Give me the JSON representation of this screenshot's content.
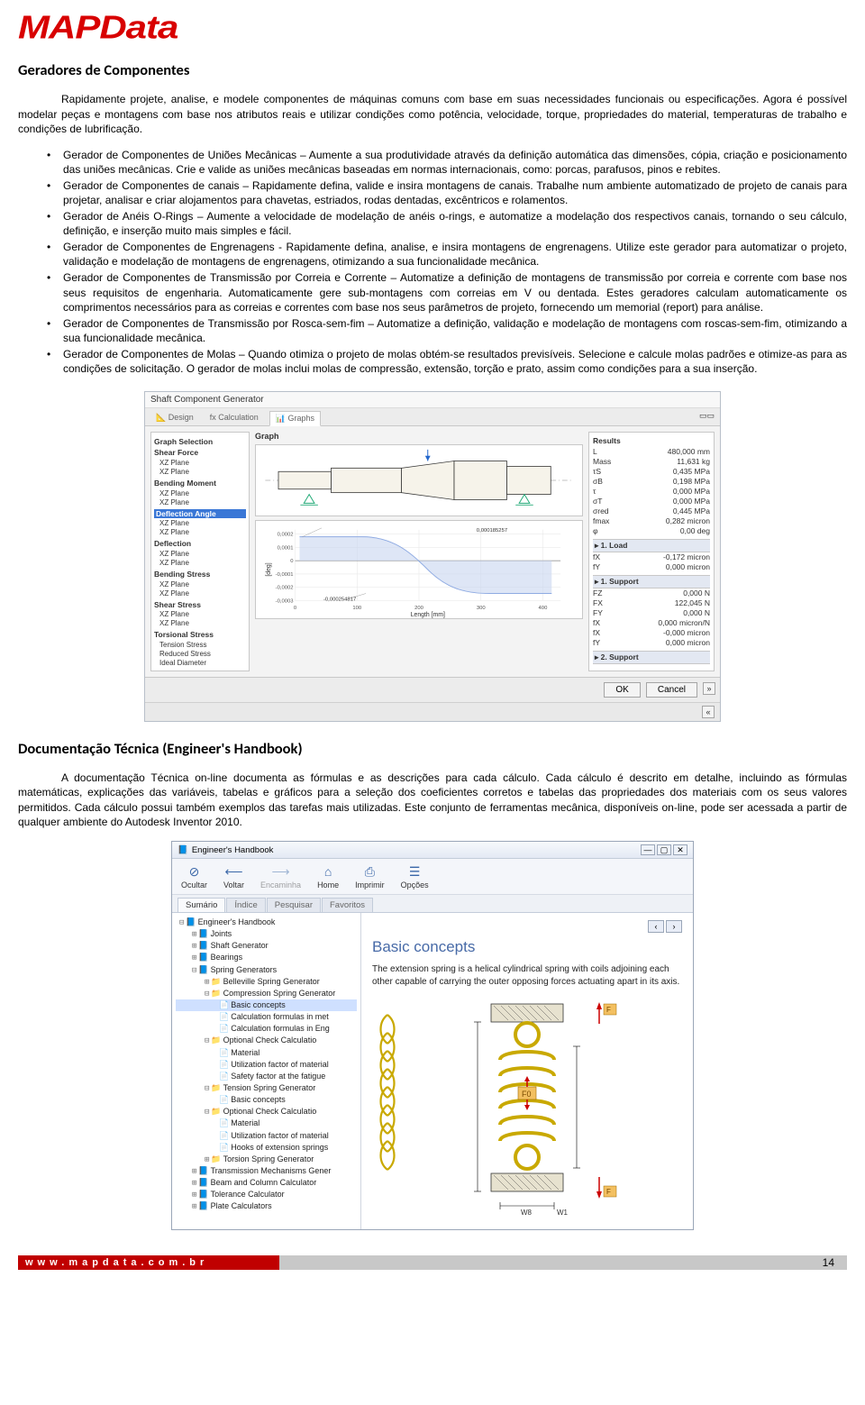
{
  "logo": "MAPData",
  "section1_title": "Geradores de Componentes",
  "p1": "Rapidamente projete, analise, e modele componentes de máquinas comuns com base em suas necessidades funcionais ou especificações. Agora é possível modelar peças e montagens com base nos atributos reais e utilizar condições como potência, velocidade, torque, propriedades do material, temperaturas de trabalho e condições de lubrificação.",
  "bullets": [
    "Gerador de Componentes de Uniões Mecânicas – Aumente a sua produtividade através da definição automática das dimensões, cópia, criação e posicionamento das uniões mecânicas. Crie e valide as uniões mecânicas baseadas em normas internacionais, como: porcas, parafusos, pinos e rebites.",
    "Gerador de Componentes de canais – Rapidamente defina, valide e insira montagens de canais. Trabalhe num ambiente automatizado de projeto de canais para projetar, analisar e criar alojamentos para chavetas, estriados, rodas dentadas, excêntricos e rolamentos.",
    "Gerador de Anéis O-Rings – Aumente a velocidade de modelação de anéis o-rings, e automatize a modelação dos respectivos canais, tornando o seu cálculo, definição, e inserção muito mais simples e fácil.",
    "Gerador de Componentes de Engrenagens - Rapidamente defina, analise, e insira montagens de engrenagens. Utilize este gerador para automatizar o projeto, validação e modelação de montagens de engrenagens, otimizando a sua funcionalidade mecânica.",
    "Gerador de Componentes de Transmissão por Correia e Corrente – Automatize a definição de montagens de transmissão por correia e corrente com base nos seus requisitos de engenharia. Automaticamente gere sub-montagens com correias em V ou dentada. Estes geradores calculam automaticamente os comprimentos necessários para as correias e correntes com base nos seus parâmetros de projeto, fornecendo um memorial (report) para análise.",
    "Gerador de Componentes de Transmissão por Rosca-sem-fim – Automatize a definição, validação e modelação de montagens com roscas-sem-fim, otimizando a sua funcionalidade mecânica.",
    "Gerador de Componentes de Molas – Quando otimiza o projeto de molas obtém-se resultados previsíveis. Selecione e calcule molas padrões e otimize-as para as condições de solicitação. O gerador de molas inclui molas de compressão, extensão, torção e prato, assim como condições para a sua inserção."
  ],
  "shaft": {
    "title": "Shaft Component Generator",
    "tabs": [
      "Design",
      "Calculation",
      "Graphs"
    ],
    "active_tab": 2,
    "left_header": "Graph Selection",
    "left_items": [
      {
        "hdr": "Shear Force"
      },
      {
        "txt": "XZ Plane"
      },
      {
        "txt": "XZ Plane"
      },
      {
        "hdr": "Bending Moment"
      },
      {
        "txt": "XZ Plane"
      },
      {
        "txt": "XZ Plane"
      },
      {
        "hdr": "Deflection Angle",
        "sel": true
      },
      {
        "txt": "XZ Plane"
      },
      {
        "txt": "XZ Plane"
      },
      {
        "hdr": "Deflection"
      },
      {
        "txt": "XZ Plane"
      },
      {
        "txt": "XZ Plane"
      },
      {
        "hdr": "Bending Stress"
      },
      {
        "txt": "XZ Plane"
      },
      {
        "txt": "XZ Plane"
      },
      {
        "hdr": "Shear Stress"
      },
      {
        "txt": "XZ Plane"
      },
      {
        "txt": "XZ Plane"
      },
      {
        "hdr": "Torsional Stress"
      },
      {
        "txt": "Tension Stress"
      },
      {
        "txt": "Reduced Stress"
      },
      {
        "txt": "Ideal Diameter"
      }
    ],
    "mid_label": "Graph",
    "plot_xlabel": "Length [mm]",
    "plot_ylabel": "[deg]",
    "plot_callout1": "0,000185257",
    "plot_callout2": "-0,000254817",
    "results_title": "Results",
    "results_rows": [
      [
        "L",
        "480,000 mm"
      ],
      [
        "Mass",
        "11,631 kg"
      ],
      [
        "τS",
        "0,435 MPa"
      ],
      [
        "σB",
        "0,198 MPa"
      ],
      [
        "τ",
        "0,000 MPa"
      ],
      [
        "σT",
        "0,000 MPa"
      ],
      [
        "σred",
        "0,445 MPa"
      ],
      [
        "fmax",
        "0,282 micron"
      ],
      [
        "φ",
        "0,00 deg"
      ]
    ],
    "load_title": "1. Load",
    "load_rows": [
      [
        "fX",
        "-0,172 micron"
      ],
      [
        "fY",
        "0,000 micron"
      ]
    ],
    "support_title": "1. Support",
    "support_rows": [
      [
        "FZ",
        "0,000 N"
      ],
      [
        "FX",
        "122,045 N"
      ],
      [
        "FY",
        "0,000 N"
      ],
      [
        "fX",
        "0,000 micron/N"
      ],
      [
        "fX",
        "-0,000 micron"
      ],
      [
        "fY",
        "0,000 micron"
      ]
    ],
    "support2_title": "2. Support",
    "btn_ok": "OK",
    "btn_cancel": "Cancel"
  },
  "chart_data": {
    "type": "line",
    "title": "Deflection Angle – XZ Plane",
    "xlabel": "Length [mm]",
    "ylabel": "[deg]",
    "x": [
      0,
      100,
      200,
      300,
      400
    ],
    "y": [
      0.000185,
      0.000185,
      5e-05,
      -0.00025,
      -0.00025
    ],
    "xlim": [
      0,
      450
    ],
    "ylim": [
      -0.0003,
      0.0002
    ],
    "yticks": [
      0.0002,
      0.0001,
      0,
      -0.0001,
      -0.0002,
      -0.0003
    ],
    "annotations": [
      {
        "x": 10,
        "y": 0.000185,
        "text": "0,000185257"
      },
      {
        "x": 120,
        "y": -0.000255,
        "text": "-0,000254817"
      }
    ]
  },
  "section2_title": "Documentação Técnica (Engineer's Handbook)",
  "p2": "A documentação Técnica on-line documenta as fórmulas e as descrições para cada cálculo. Cada cálculo é descrito em detalhe, incluindo as fórmulas matemáticas, explicações das variáveis, tabelas e gráficos para a seleção dos coeficientes corretos e tabelas das propriedades dos materiais com os seus valores permitidos. Cada cálculo possui também exemplos das tarefas mais utilizadas. Este conjunto de ferramentas mecânica, disponíveis on-line, pode ser acessada a partir de qualquer ambiente do Autodesk Inventor 2010.",
  "hb": {
    "title": "Engineer's Handbook",
    "toolbar": [
      {
        "icon": "⊘",
        "label": "Ocultar"
      },
      {
        "icon": "⟵",
        "label": "Voltar"
      },
      {
        "icon": "⟶",
        "label": "Encaminha"
      },
      {
        "icon": "⌂",
        "label": "Home"
      },
      {
        "icon": "⎙",
        "label": "Imprimir"
      },
      {
        "icon": "☰",
        "label": "Opções"
      }
    ],
    "tabs": [
      "Sumário",
      "Índice",
      "Pesquisar",
      "Favoritos"
    ],
    "tree": [
      {
        "lvl": 0,
        "exp": "⊟",
        "ico": "book",
        "txt": "Engineer's Handbook"
      },
      {
        "lvl": 1,
        "exp": "⊞",
        "ico": "book",
        "txt": "Joints"
      },
      {
        "lvl": 1,
        "exp": "⊞",
        "ico": "book",
        "txt": "Shaft Generator"
      },
      {
        "lvl": 1,
        "exp": "⊞",
        "ico": "book",
        "txt": "Bearings"
      },
      {
        "lvl": 1,
        "exp": "⊟",
        "ico": "book",
        "txt": "Spring Generators"
      },
      {
        "lvl": 2,
        "exp": "⊞",
        "ico": "folder",
        "txt": "Belleville Spring Generator"
      },
      {
        "lvl": 2,
        "exp": "⊟",
        "ico": "folder",
        "txt": "Compression Spring Generator"
      },
      {
        "lvl": 3,
        "exp": "",
        "ico": "page",
        "txt": "Basic concepts",
        "sel": true
      },
      {
        "lvl": 3,
        "exp": "",
        "ico": "page",
        "txt": "Calculation formulas in met"
      },
      {
        "lvl": 3,
        "exp": "",
        "ico": "page",
        "txt": "Calculation formulas in Eng"
      },
      {
        "lvl": 2,
        "exp": "⊟",
        "ico": "folder",
        "txt": "Optional Check Calculatio"
      },
      {
        "lvl": 3,
        "exp": "",
        "ico": "page",
        "txt": "Material"
      },
      {
        "lvl": 3,
        "exp": "",
        "ico": "page",
        "txt": "Utilization factor of material"
      },
      {
        "lvl": 3,
        "exp": "",
        "ico": "page",
        "txt": "Safety factor at the fatigue"
      },
      {
        "lvl": 2,
        "exp": "⊟",
        "ico": "folder",
        "txt": "Tension Spring Generator"
      },
      {
        "lvl": 3,
        "exp": "",
        "ico": "page",
        "txt": "Basic concepts"
      },
      {
        "lvl": 2,
        "exp": "⊟",
        "ico": "folder",
        "txt": "Optional Check Calculatio"
      },
      {
        "lvl": 3,
        "exp": "",
        "ico": "page",
        "txt": "Material"
      },
      {
        "lvl": 3,
        "exp": "",
        "ico": "page",
        "txt": "Utilization factor of material"
      },
      {
        "lvl": 3,
        "exp": "",
        "ico": "page",
        "txt": "Hooks of extension springs"
      },
      {
        "lvl": 2,
        "exp": "⊞",
        "ico": "folder",
        "txt": "Torsion Spring Generator"
      },
      {
        "lvl": 1,
        "exp": "⊞",
        "ico": "book",
        "txt": "Transmission Mechanisms Gener"
      },
      {
        "lvl": 1,
        "exp": "⊞",
        "ico": "book",
        "txt": "Beam and Column Calculator"
      },
      {
        "lvl": 1,
        "exp": "⊞",
        "ico": "book",
        "txt": "Tolerance Calculator"
      },
      {
        "lvl": 1,
        "exp": "⊞",
        "ico": "book",
        "txt": "Plate Calculators"
      }
    ],
    "content_title": "Basic concepts",
    "content_p": "The extension spring is a helical cylindrical spring with coils adjoining each other capable of carrying the outer opposing forces actuating apart in its axis.",
    "labels": {
      "F0": "F0",
      "F": "F",
      "F2": "F",
      "W8": "W8",
      "W1": "W1"
    }
  },
  "footer_url": "www.mapdata.com.br",
  "footer_page": "14"
}
